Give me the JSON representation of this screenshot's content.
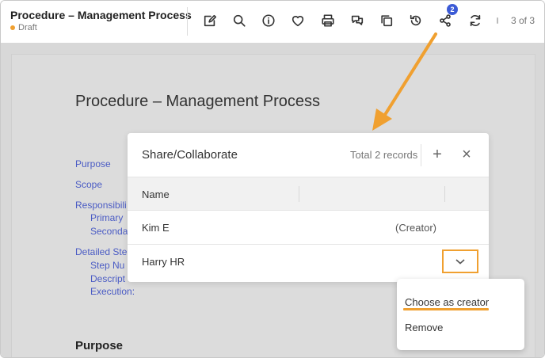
{
  "header": {
    "title": "Procedure – Management Process",
    "status": "Draft",
    "share_badge": "2",
    "page_count": "3 of 3",
    "tools": [
      "edit-icon",
      "search-icon",
      "info-icon",
      "favorite-icon",
      "print-icon",
      "comments-icon",
      "copy-icon",
      "history-icon",
      "share-icon",
      "refresh-icon"
    ]
  },
  "document": {
    "title": "Procedure – Management Process",
    "toc": [
      "Purpose",
      "Scope",
      "Responsibili",
      "Primary",
      "Seconda",
      "Detailed Ste",
      "Step Nu",
      "Descript",
      "Execution:"
    ],
    "section_heading": "Purpose"
  },
  "modal": {
    "title": "Share/Collaborate",
    "records": "Total 2 records",
    "add_label": "+",
    "close_label": "×",
    "columns": [
      "Name",
      "",
      ""
    ],
    "rows": [
      {
        "name": "Kim E",
        "role": "(Creator)"
      },
      {
        "name": "Harry HR",
        "role": ""
      }
    ]
  },
  "menu": {
    "items": [
      "Choose as creator",
      "Remove"
    ]
  },
  "colors": {
    "accent": "#f0a030",
    "badge": "#3c5bd6",
    "link": "#4a5bc4"
  }
}
